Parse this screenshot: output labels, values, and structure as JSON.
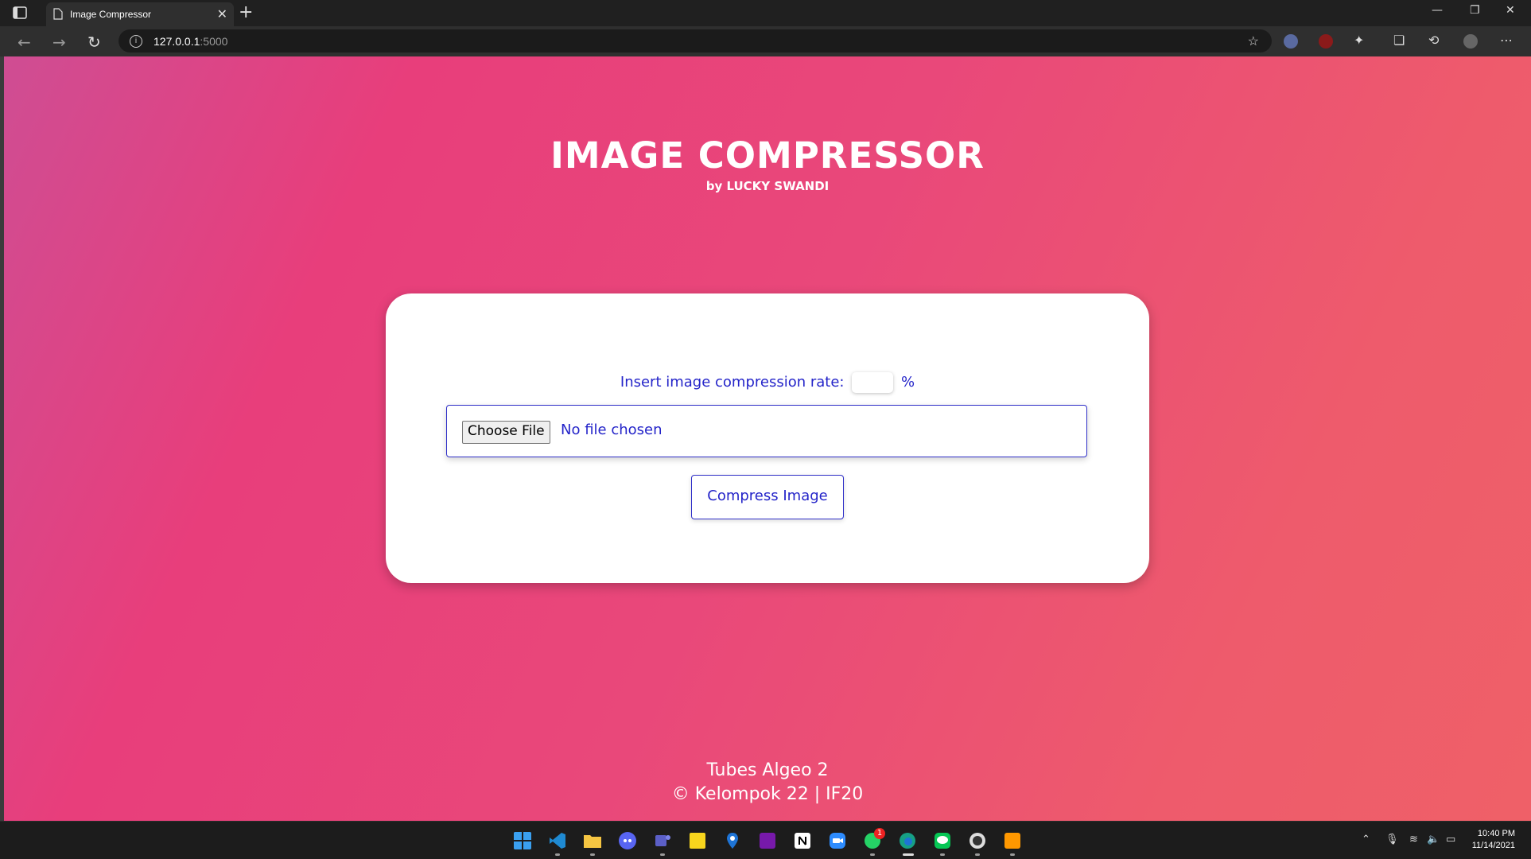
{
  "browser": {
    "tab_title": "Image Compressor",
    "url_host": "127.0.0.1",
    "url_port": ":5000"
  },
  "page": {
    "title": "IMAGE COMPRESSOR",
    "subtitle": "by LUCKY SWANDI",
    "form": {
      "rate_label": "Insert image compression rate:",
      "rate_value": "",
      "rate_unit": "%",
      "choose_file_label": "Choose File",
      "file_status": "No file chosen",
      "submit_label": "Compress Image"
    },
    "footer": {
      "line1": "Tubes Algeo 2",
      "line2": "© Kelompok 22 | IF20"
    }
  },
  "taskbar": {
    "apps": [
      "start-icon",
      "vscode-icon",
      "file-explorer-icon",
      "discord-icon",
      "teams-icon",
      "sticky-notes-icon",
      "maps-icon",
      "onenote-icon",
      "notion-icon",
      "zoom-icon",
      "whatsapp-icon",
      "edge-icon",
      "line-icon",
      "github-desktop-icon",
      "sublime-icon"
    ],
    "whatsapp_badge": "1",
    "time": "10:40 PM",
    "date": "11/14/2021"
  },
  "colors": {
    "accent_text": "#2424c9",
    "gradient_start": "#cf4d93",
    "gradient_end": "#ef6068"
  }
}
